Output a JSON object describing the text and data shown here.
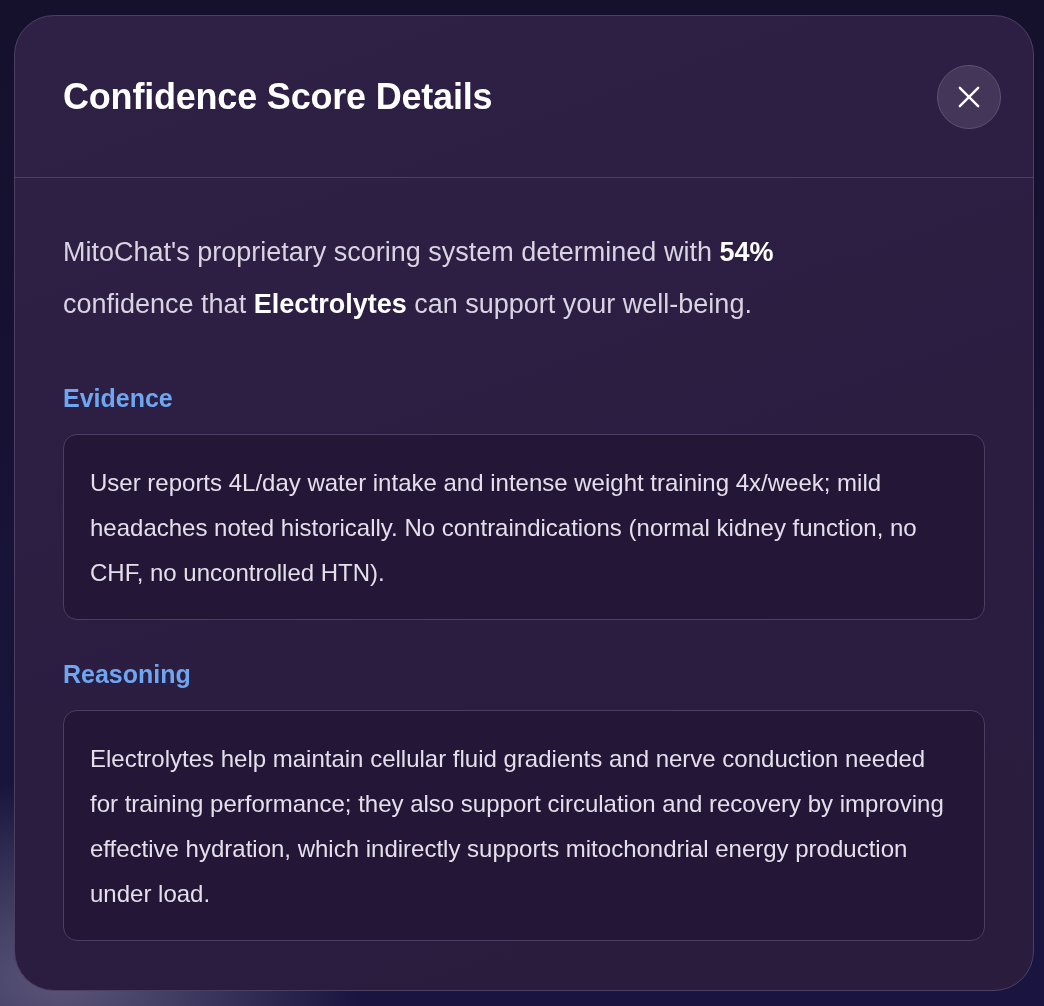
{
  "dialog": {
    "title": "Confidence Score Details",
    "intro": "MitoChat's proprietary scoring system determined with **54%** confidence that **Electrolytes** can support your well-being.",
    "sections": [
      {
        "heading": "Evidence",
        "text": "User reports 4L/day water intake and intense weight training 4x/week; mild headaches noted historically. No contraindications (normal kidney function, no CHF, no uncontrolled HTN)."
      },
      {
        "heading": "Reasoning",
        "text": "Electrolytes help maintain cellular fluid gradients and nerve conduction needed for training performance; they also support circulation and recovery by improving effective hydration, which indirectly supports mitochondrial energy production under load."
      }
    ]
  }
}
